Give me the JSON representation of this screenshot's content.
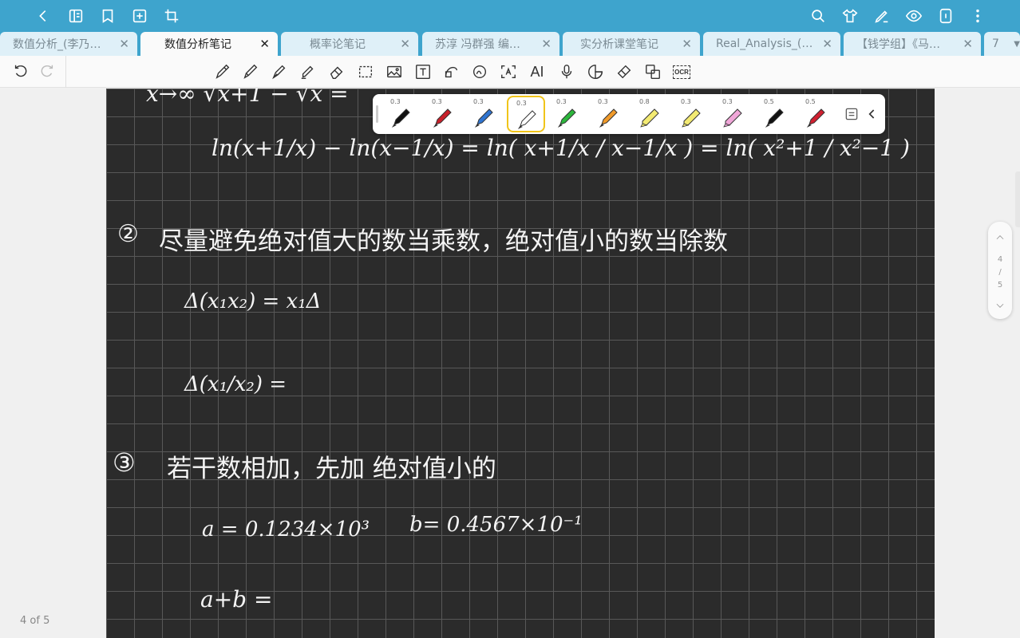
{
  "tabs": [
    {
      "label": "数值分析_(李乃…",
      "active": false
    },
    {
      "label": "数值分析笔记",
      "active": true
    },
    {
      "label": "概率论笔记",
      "active": false
    },
    {
      "label": "苏淳 冯群强 编…",
      "active": false
    },
    {
      "label": "实分析课堂笔记",
      "active": false
    },
    {
      "label": "Real_Analysis_(…",
      "active": false
    },
    {
      "label": "【钱学组】《马…",
      "active": false
    }
  ],
  "tab_close_glyph": "✕",
  "tab_overflow": {
    "count": "7"
  },
  "topbar_left_icons": [
    "back-icon",
    "outline-icon",
    "bookmark-icon",
    "add-page-icon",
    "crop-icon"
  ],
  "topbar_right_icons": [
    "search-icon",
    "theme-icon",
    "pen-mode-icon",
    "view-icon",
    "device-icon",
    "more-icon"
  ],
  "toolbar": {
    "ai_label": "AI",
    "ocr_label": "OCR",
    "tools": [
      "pen-icon",
      "pencil-icon",
      "fountain-pen-icon",
      "highlighter-icon",
      "eraser-icon",
      "lasso-select-icon",
      "image-icon",
      "text-icon",
      "shape-icon",
      "ink-to-text-icon",
      "text-recognition-icon",
      "ai-icon",
      "microphone-icon",
      "sticker-icon",
      "tape-icon",
      "translate-icon",
      "ocr-icon"
    ]
  },
  "pens": [
    {
      "width": "0.3",
      "color": "#111111",
      "type": "pen"
    },
    {
      "width": "0.3",
      "color": "#c8202a",
      "type": "pen"
    },
    {
      "width": "0.3",
      "color": "#2f74d0",
      "type": "pen"
    },
    {
      "width": "0.3",
      "color": "#ffffff",
      "type": "pen",
      "selected": true
    },
    {
      "width": "0.3",
      "color": "#2cb63c",
      "type": "pen"
    },
    {
      "width": "0.3",
      "color": "#f09a2a",
      "type": "pen"
    },
    {
      "width": "0.8",
      "color": "#f3ea72",
      "type": "marker"
    },
    {
      "width": "0.3",
      "color": "#f3ea72",
      "type": "marker"
    },
    {
      "width": "0.3",
      "color": "#f0a6d8",
      "type": "marker"
    },
    {
      "width": "0.5",
      "color": "#111111",
      "type": "pen"
    },
    {
      "width": "0.5",
      "color": "#d02030",
      "type": "pen"
    }
  ],
  "notes": {
    "line0": "x→∞  √x+1  −  √x  =",
    "line1": "ln(x+1/x) − ln(x−1/x)  =  ln( x+1/x / x−1/x ) = ln( x²+1 / x²−1 )",
    "rule2_num": "②",
    "rule2": "尽量避免绝对值大的数当乘数，绝对值小的数当除数",
    "delta1": "Δ(x₁x₂) = x₁Δ",
    "delta2": "Δ(x₁/x₂) =",
    "rule3_num": "③",
    "rule3": "若干数相加，先加 绝对值小的",
    "a_eq": "a = 0.1234×10³",
    "b_eq": "b= 0.4567×10⁻¹",
    "sum": "a+b ="
  },
  "scroller": {
    "current": "4",
    "sep": "/",
    "total": "5"
  },
  "page_indicator": "4 of 5"
}
